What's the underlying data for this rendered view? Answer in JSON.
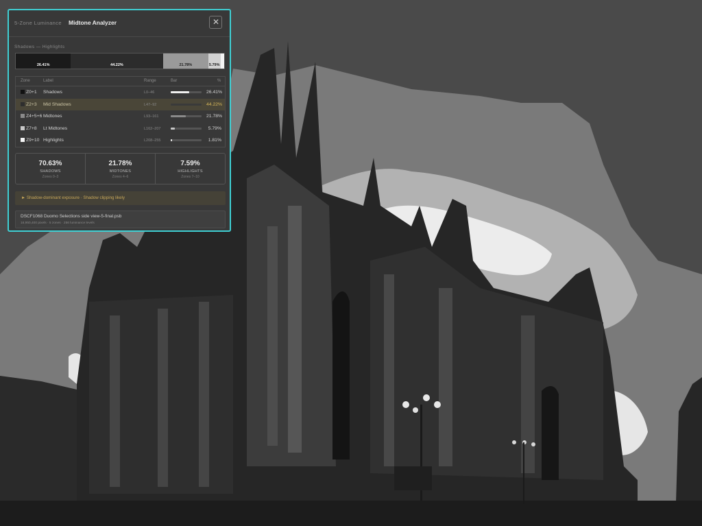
{
  "panel": {
    "subtitle": "5-Zone Luminance",
    "title": "Midtone Analyzer",
    "range_caption": "Shadows — Highlights",
    "close_icon": "close-icon",
    "accent_color": "#3fd0d4"
  },
  "strip": [
    {
      "label": "26.41%",
      "value": 26.41,
      "color": "#1a1a1a",
      "text_color": "#ffffff"
    },
    {
      "label": "44.22%",
      "value": 44.22,
      "color": "#2c2c2c",
      "text_color": "#ffffff"
    },
    {
      "label": "21.78%",
      "value": 21.78,
      "color": "#9a9a9a",
      "text_color": "#1a1a1a"
    },
    {
      "label": "5.79%",
      "value": 5.79,
      "color": "#d2d2d2",
      "text_color": "#1a1a1a"
    },
    {
      "label": "",
      "value": 1.81,
      "color": "#f4f4f4",
      "text_color": "#1a1a1a"
    }
  ],
  "table": {
    "headers": {
      "zone": "Zone",
      "label": "Label",
      "range": "Range",
      "bar": "Bar",
      "pct": "%"
    },
    "rows": [
      {
        "zone": "Z0+1",
        "label": "Shadows",
        "range": "L0–46",
        "pct": "26.41%",
        "value": 26.41,
        "swatch": "#111111",
        "bar": "#f0f0f0"
      },
      {
        "zone": "Z2+3",
        "label": "Mid Shadows",
        "range": "L47–92",
        "pct": "44.22%",
        "value": 44.22,
        "swatch": "#2e2e2e",
        "bar": "#3a3a3a"
      },
      {
        "zone": "Z4+5+6",
        "label": "Midtones",
        "range": "L93–161",
        "pct": "21.78%",
        "value": 21.78,
        "swatch": "#8a8a8a",
        "bar": "#8a8a8a"
      },
      {
        "zone": "Z7+8",
        "label": "Lt Midtones",
        "range": "L162–207",
        "pct": "5.79%",
        "value": 5.79,
        "swatch": "#c8c8c8",
        "bar": "#c8c8c8"
      },
      {
        "zone": "Z9+10",
        "label": "Highlights",
        "range": "L208–255",
        "pct": "1.81%",
        "value": 1.81,
        "swatch": "#f4f4f4",
        "bar": "#f4f4f4"
      }
    ]
  },
  "stats": [
    {
      "value": "70.63%",
      "label": "SHADOWS",
      "zones": "Zones 0–3"
    },
    {
      "value": "21.78%",
      "label": "MIDTONES",
      "zones": "Zones 4–6"
    },
    {
      "value": "7.59%",
      "label": "HIGHLIGHTS",
      "zones": "Zones 7–10"
    }
  ],
  "warning": "► Shadow-dominant exposure · Shadow clipping likely",
  "file": {
    "name": "DSCF1068 Duomo Selections side view-5-final.psb",
    "meta": "16,950,400 pixels · 5 zones · 256 luminance levels"
  }
}
